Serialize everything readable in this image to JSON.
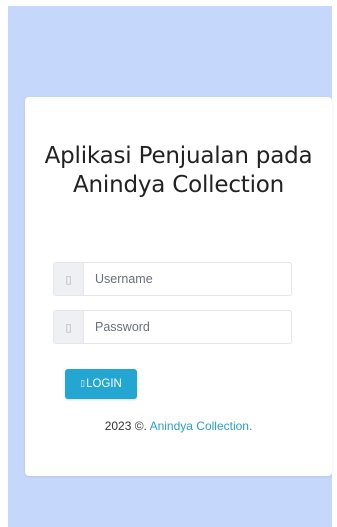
{
  "app": {
    "title": "Aplikasi Penjualan pada Anindya Collection"
  },
  "login_form": {
    "username_placeholder": "Username",
    "username_icon": "user-icon",
    "password_placeholder": "Password",
    "password_icon": "lock-icon",
    "login_label": "LOGIN",
    "login_icon": "sign-in-icon"
  },
  "footer": {
    "copyright": "2023 ©.",
    "brand_link": "Anindya Collection."
  },
  "colors": {
    "page_background": "#c5d8fb",
    "card_background": "#ffffff",
    "button": "#24a6d3",
    "link": "#2a9fc9"
  }
}
